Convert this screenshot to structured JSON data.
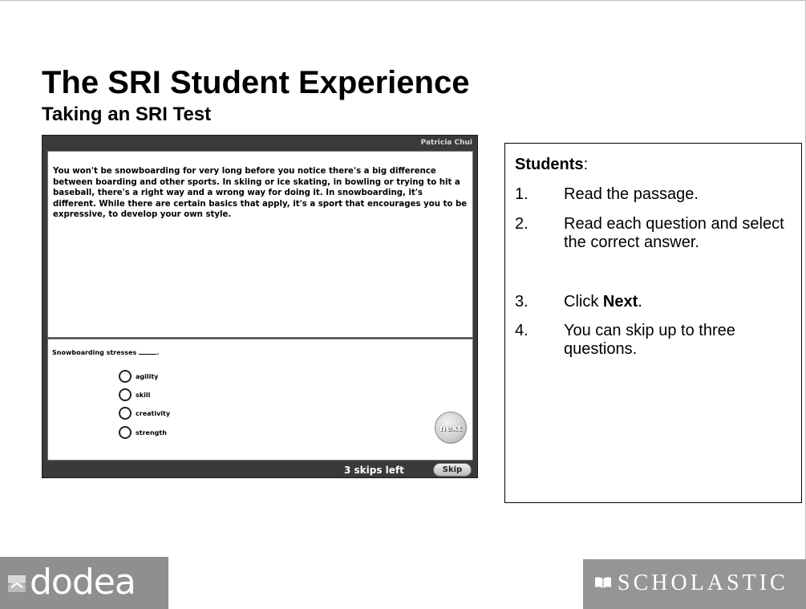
{
  "slide": {
    "title": "The SRI Student Experience",
    "subtitle": "Taking an SRI Test"
  },
  "test": {
    "student_name": "Patricia Chui",
    "passage": "You won't be snowboarding for very long before you notice there's a big difference between boarding and other sports. In skiing or ice skating, in bowling or trying to hit a baseball, there's a right way and a wrong way for doing it. In snowboarding, it's different. While there are certain basics that apply, it's a sport that encourages you to be expressive, to develop your own style.",
    "question": "Snowboarding stresses",
    "answers": [
      "agility",
      "skill",
      "creativity",
      "strength"
    ],
    "next_label": "next",
    "skips_left": "3 skips left",
    "skip_label": "Skip"
  },
  "instructions": {
    "heading": "Students",
    "heading_suffix": ":",
    "steps": [
      {
        "num": "1.",
        "text": "Read the passage."
      },
      {
        "num": "2.",
        "text": "Read each question and select the correct answer."
      },
      {
        "num": "3.",
        "text_prefix": "Click ",
        "text_bold": "Next",
        "text_suffix": "."
      },
      {
        "num": "4.",
        "text": "You can skip up to three questions."
      }
    ]
  },
  "logos": {
    "dodea": "dodea",
    "scholastic": "SCHOLASTIC"
  },
  "colors": {
    "frame": "#3a3a3a",
    "logo_gray": "#8f8f8f"
  }
}
